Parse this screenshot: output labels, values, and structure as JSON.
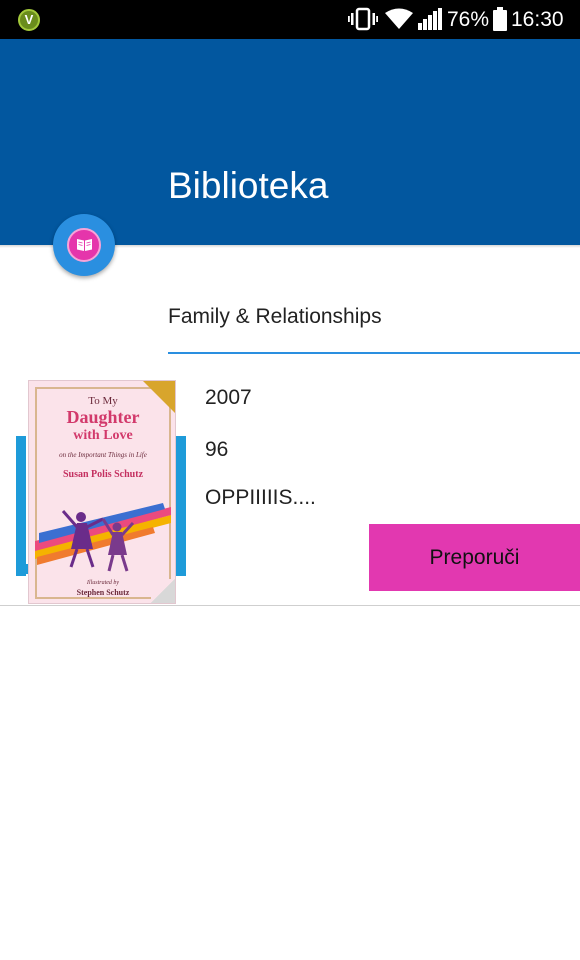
{
  "status_bar": {
    "carrier_logo_letter": "V",
    "battery_percent": "76%",
    "time": "16:30",
    "icons": [
      "vibrate-icon",
      "wifi-icon",
      "signal-icon",
      "battery-icon"
    ]
  },
  "app_bar": {
    "title": "Biblioteka",
    "background_color": "#02579f",
    "fab_icon": "book-open-icon"
  },
  "category": {
    "label": "Family & Relationships",
    "underline_color": "#2a8fe0"
  },
  "book": {
    "cover": {
      "line1": "To My",
      "line2": "Daughter",
      "line3": "with Love",
      "line4": "on the Important Things in Life",
      "author": "Susan Polis Schutz",
      "illustrated_by": "Illustrated by",
      "illustrator": "Stephen Schutz"
    },
    "year": "2007",
    "pages": "96",
    "description": "OPPIIIIIS....",
    "recommend_label": "Preporuči",
    "recommend_color": "#e238b0"
  }
}
